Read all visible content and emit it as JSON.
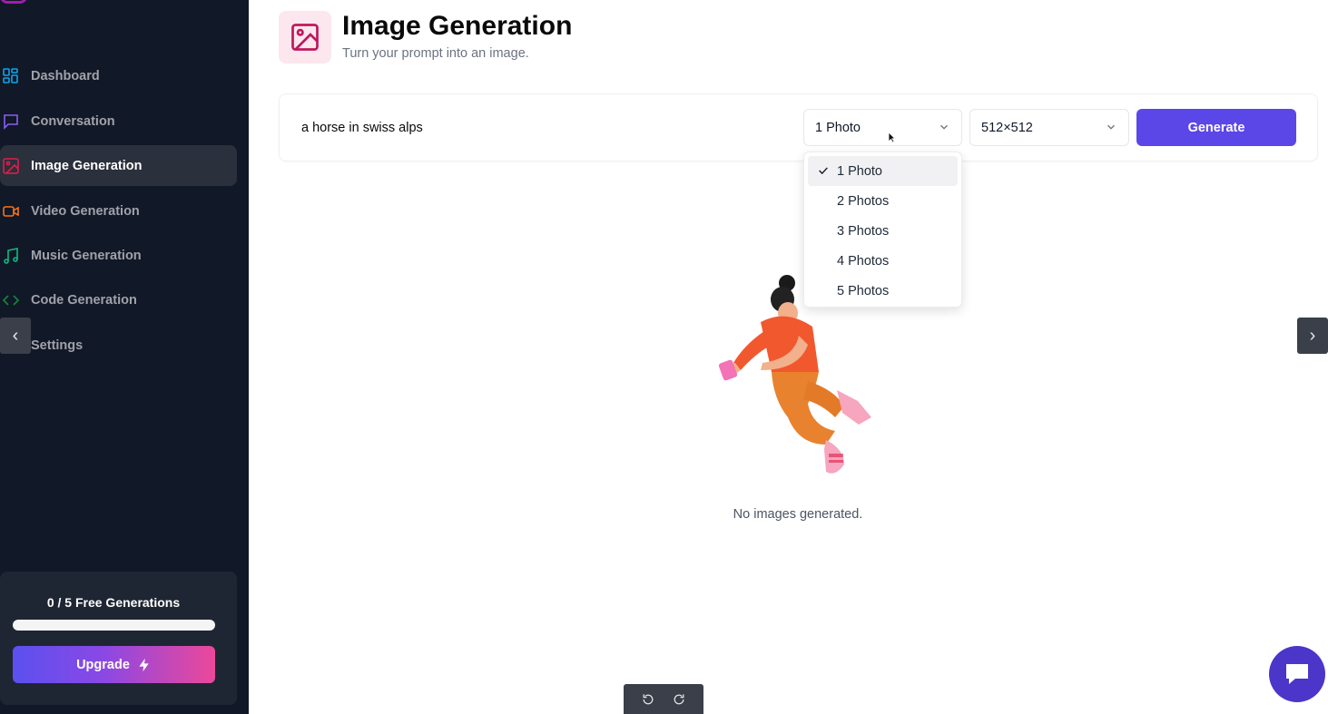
{
  "sidebar": {
    "items": [
      {
        "label": "Dashboard",
        "icon": "dashboard-icon",
        "color": "#0ea5e9"
      },
      {
        "label": "Conversation",
        "icon": "message-square-icon",
        "color": "#8b5cf6"
      },
      {
        "label": "Image Generation",
        "icon": "image-icon",
        "color": "#e11d48",
        "active": true
      },
      {
        "label": "Video Generation",
        "icon": "video-icon",
        "color": "#f97316"
      },
      {
        "label": "Music Generation",
        "icon": "music-icon",
        "color": "#10b981"
      },
      {
        "label": "Code Generation",
        "icon": "code-icon",
        "color": "#15803d"
      },
      {
        "label": "Settings",
        "icon": "settings-icon",
        "color": "#9ca3af"
      }
    ],
    "usage": {
      "text": "0 / 5 Free Generations",
      "used": 0,
      "limit": 5
    },
    "upgrade_label": "Upgrade"
  },
  "header": {
    "title": "Image Generation",
    "subtitle": "Turn your prompt into an image.",
    "icon": "image-icon",
    "accent": "#be185d"
  },
  "form": {
    "prompt_value": "a horse in swiss alps",
    "amount_selected": "1 Photo",
    "resolution_selected": "512×512",
    "generate_label": "Generate",
    "accent": "#5b46e8"
  },
  "dropdown": {
    "options": [
      "1 Photo",
      "2 Photos",
      "3 Photos",
      "4 Photos",
      "5 Photos"
    ],
    "selected_index": 0
  },
  "empty_state": {
    "text": "No images generated."
  },
  "nav_arrows": {
    "left": "‹",
    "right": "›"
  }
}
